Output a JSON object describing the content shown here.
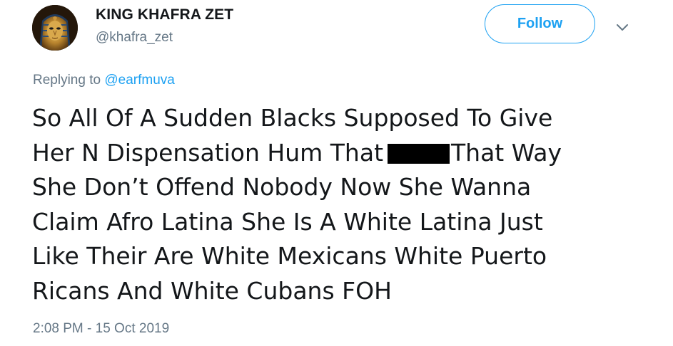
{
  "author": {
    "display_name": "KING KHAFRA ZET",
    "handle": "@khafra_zet",
    "avatar_icon": "golden-pharaoh-mask-avatar"
  },
  "actions": {
    "follow_label": "Follow",
    "more_icon": "chevron-down-icon"
  },
  "reply_context": {
    "prefix": "Replying to",
    "mention": "@earfmuva"
  },
  "tweet": {
    "lines": [
      "So All Of A Sudden Blacks Supposed To Give",
      "Her N Dispensation Hum That",
      "That Way",
      "She Don’t Offend Nobody Now She Wanna",
      "Claim Afro Latina She Is A White Latina Just",
      "Like Their Are White Mexicans White  Puerto",
      "Ricans And White Cubans FOH"
    ],
    "redacted_word": "redaction-bar"
  },
  "timestamp": "2:08 PM - 15 Oct 2019",
  "colors": {
    "accent": "#1da1f2",
    "text_primary": "#14171a",
    "text_secondary": "#657786"
  }
}
